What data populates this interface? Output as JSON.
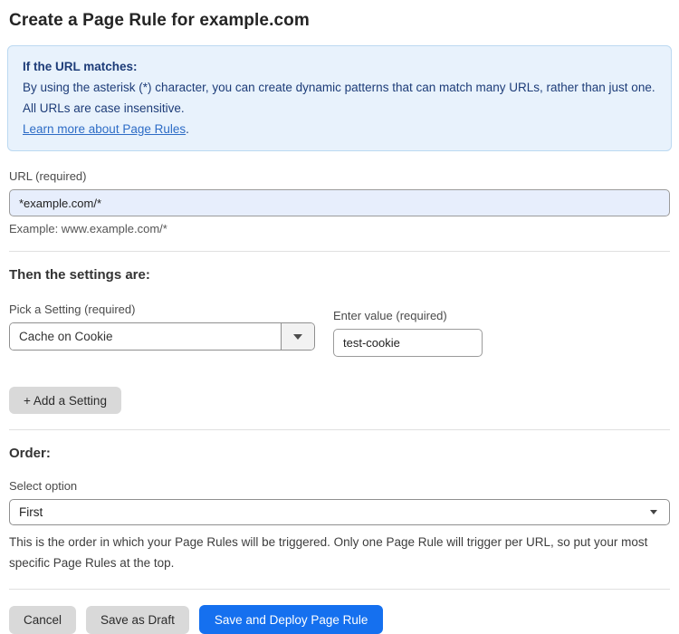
{
  "page": {
    "title": "Create a Page Rule for example.com"
  },
  "info_box": {
    "heading": "If the URL matches:",
    "body": "By using the asterisk (*) character, you can create dynamic patterns that can match many URLs, rather than just one. All URLs are case insensitive.",
    "link_label": "Learn more about Page Rules",
    "link_suffix": "."
  },
  "url_field": {
    "label": "URL (required)",
    "value": "*example.com/*",
    "helper": "Example: www.example.com/*"
  },
  "settings_section": {
    "heading": "Then the settings are:",
    "setting_label": "Pick a Setting (required)",
    "setting_selected": "Cache on Cookie",
    "value_label": "Enter value (required)",
    "value_text": "test-cookie",
    "add_button_label": "+ Add a Setting"
  },
  "order_section": {
    "heading": "Order:",
    "select_label": "Select option",
    "selected_option": "First",
    "helper": "This is the order in which your Page Rules will be triggered. Only one Page Rule will trigger per URL, so put your most specific Page Rules at the top."
  },
  "footer": {
    "cancel_label": "Cancel",
    "save_draft_label": "Save as Draft",
    "save_deploy_label": "Save and Deploy Page Rule"
  },
  "colors": {
    "accent_blue": "#1570ef",
    "info_background": "#e8f2fc",
    "info_border": "#bcd9f1",
    "info_text": "#1d3c78",
    "link_blue": "#2d6cc6",
    "url_input_background": "#e7eefc",
    "gray_button": "#d9d9d9"
  }
}
